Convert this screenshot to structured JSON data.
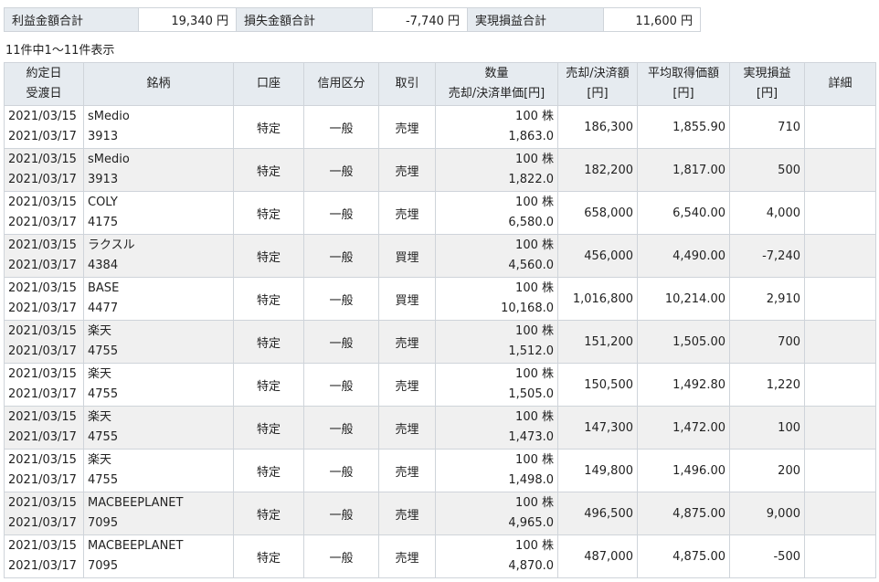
{
  "summary": {
    "profit_label": "利益金額合計",
    "profit_value": "19,340 円",
    "loss_label": "損失金額合計",
    "loss_value": "-7,740 円",
    "realized_label": "実現損益合計",
    "realized_value": "11,600 円"
  },
  "count_text": "11件中1～11件表示",
  "headers": {
    "date_line1": "約定日",
    "date_line2": "受渡日",
    "name": "銘柄",
    "account": "口座",
    "credit": "信用区分",
    "trade": "取引",
    "qty_line1": "数量",
    "qty_line2": "売却/決済単価[円]",
    "amount_line1": "売却/決済額",
    "amount_line2": "[円]",
    "avg_line1": "平均取得価額",
    "avg_line2": "[円]",
    "pl_line1": "実現損益",
    "pl_line2": "[円]",
    "detail": "詳細"
  },
  "rows": [
    {
      "trade_date": "2021/03/15",
      "settle_date": "2021/03/17",
      "name": "sMedio",
      "code": "3913",
      "account": "特定",
      "credit": "一般",
      "trade": "売埋",
      "qty": "100 株",
      "unit_price": "1,863.0",
      "amount": "186,300",
      "avg_cost": "1,855.90",
      "pl": "710"
    },
    {
      "trade_date": "2021/03/15",
      "settle_date": "2021/03/17",
      "name": "sMedio",
      "code": "3913",
      "account": "特定",
      "credit": "一般",
      "trade": "売埋",
      "qty": "100 株",
      "unit_price": "1,822.0",
      "amount": "182,200",
      "avg_cost": "1,817.00",
      "pl": "500"
    },
    {
      "trade_date": "2021/03/15",
      "settle_date": "2021/03/17",
      "name": "COLY",
      "code": "4175",
      "account": "特定",
      "credit": "一般",
      "trade": "売埋",
      "qty": "100 株",
      "unit_price": "6,580.0",
      "amount": "658,000",
      "avg_cost": "6,540.00",
      "pl": "4,000"
    },
    {
      "trade_date": "2021/03/15",
      "settle_date": "2021/03/17",
      "name": "ラクスル",
      "code": "4384",
      "account": "特定",
      "credit": "一般",
      "trade": "買埋",
      "qty": "100 株",
      "unit_price": "4,560.0",
      "amount": "456,000",
      "avg_cost": "4,490.00",
      "pl": "-7,240"
    },
    {
      "trade_date": "2021/03/15",
      "settle_date": "2021/03/17",
      "name": "BASE",
      "code": "4477",
      "account": "特定",
      "credit": "一般",
      "trade": "買埋",
      "qty": "100 株",
      "unit_price": "10,168.0",
      "amount": "1,016,800",
      "avg_cost": "10,214.00",
      "pl": "2,910"
    },
    {
      "trade_date": "2021/03/15",
      "settle_date": "2021/03/17",
      "name": "楽天",
      "code": "4755",
      "account": "特定",
      "credit": "一般",
      "trade": "売埋",
      "qty": "100 株",
      "unit_price": "1,512.0",
      "amount": "151,200",
      "avg_cost": "1,505.00",
      "pl": "700"
    },
    {
      "trade_date": "2021/03/15",
      "settle_date": "2021/03/17",
      "name": "楽天",
      "code": "4755",
      "account": "特定",
      "credit": "一般",
      "trade": "売埋",
      "qty": "100 株",
      "unit_price": "1,505.0",
      "amount": "150,500",
      "avg_cost": "1,492.80",
      "pl": "1,220"
    },
    {
      "trade_date": "2021/03/15",
      "settle_date": "2021/03/17",
      "name": "楽天",
      "code": "4755",
      "account": "特定",
      "credit": "一般",
      "trade": "売埋",
      "qty": "100 株",
      "unit_price": "1,473.0",
      "amount": "147,300",
      "avg_cost": "1,472.00",
      "pl": "100"
    },
    {
      "trade_date": "2021/03/15",
      "settle_date": "2021/03/17",
      "name": "楽天",
      "code": "4755",
      "account": "特定",
      "credit": "一般",
      "trade": "売埋",
      "qty": "100 株",
      "unit_price": "1,498.0",
      "amount": "149,800",
      "avg_cost": "1,496.00",
      "pl": "200"
    },
    {
      "trade_date": "2021/03/15",
      "settle_date": "2021/03/17",
      "name": "MACBEEPLANET",
      "code": "7095",
      "account": "特定",
      "credit": "一般",
      "trade": "売埋",
      "qty": "100 株",
      "unit_price": "4,965.0",
      "amount": "496,500",
      "avg_cost": "4,875.00",
      "pl": "9,000"
    },
    {
      "trade_date": "2021/03/15",
      "settle_date": "2021/03/17",
      "name": "MACBEEPLANET",
      "code": "7095",
      "account": "特定",
      "credit": "一般",
      "trade": "売埋",
      "qty": "100 株",
      "unit_price": "4,870.0",
      "amount": "487,000",
      "avg_cost": "4,875.00",
      "pl": "-500"
    }
  ]
}
